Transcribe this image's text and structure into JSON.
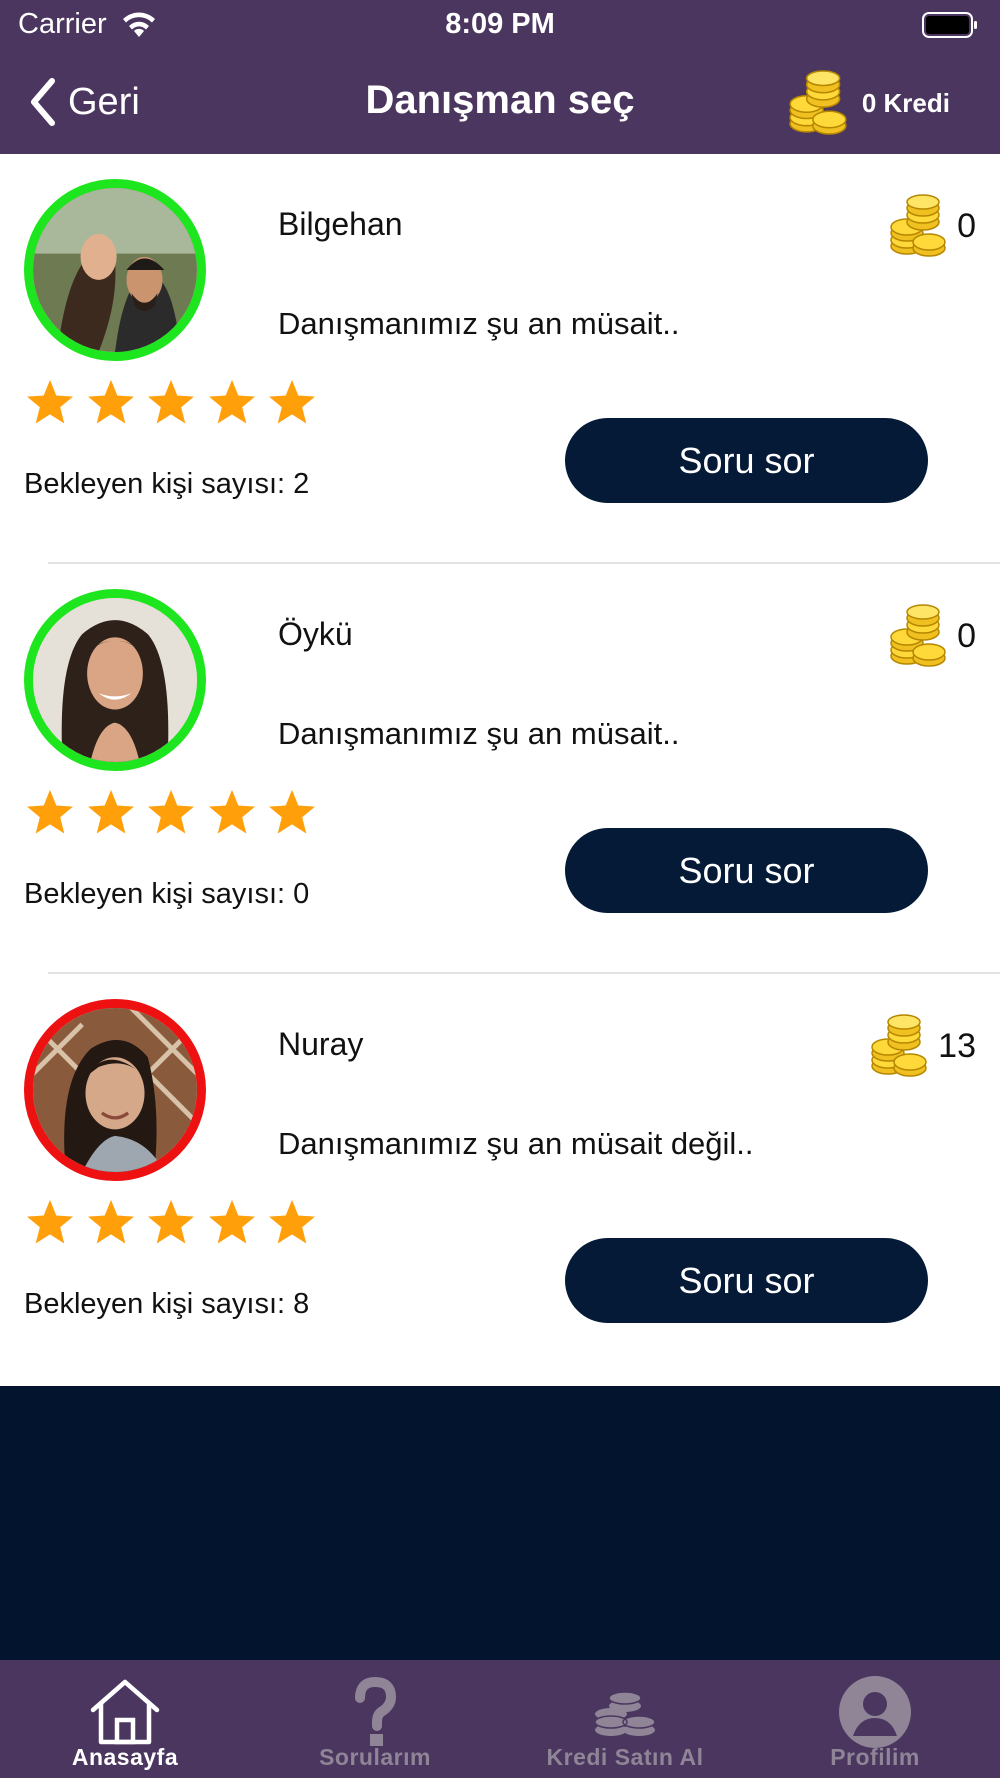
{
  "status_bar": {
    "carrier": "Carrier",
    "time": "8:09 PM"
  },
  "nav": {
    "back_label": "Geri",
    "title": "Danışman seç",
    "credit_label": "0 Kredi"
  },
  "advisors": [
    {
      "name": "Bilgehan",
      "status": "Danışmanımız şu an müsait..",
      "price": "0",
      "rating": 5,
      "waiting": "Bekleyen kişi sayısı: 2",
      "button": "Soru sor",
      "online": true
    },
    {
      "name": "Öykü",
      "status": "Danışmanımız şu an müsait..",
      "price": "0",
      "rating": 5,
      "waiting": "Bekleyen kişi sayısı: 0",
      "button": "Soru sor",
      "online": true
    },
    {
      "name": "Nuray",
      "status": "Danışmanımız şu an müsait değil..",
      "price": "13",
      "rating": 5,
      "waiting": "Bekleyen kişi sayısı: 8",
      "button": "Soru sor",
      "online": false
    }
  ],
  "tabs": [
    {
      "label": "Anasayfa",
      "icon": "home-icon",
      "active": true
    },
    {
      "label": "Sorularım",
      "icon": "question-icon",
      "active": false
    },
    {
      "label": "Kredi Satın Al",
      "icon": "coin-stack-icon",
      "active": false
    },
    {
      "label": "Profilim",
      "icon": "profile-icon",
      "active": false
    }
  ],
  "colors": {
    "header": "#4b365f",
    "button": "#051a37",
    "online": "#1ee61e",
    "offline": "#ee1111",
    "star": "#ff9f0a"
  }
}
